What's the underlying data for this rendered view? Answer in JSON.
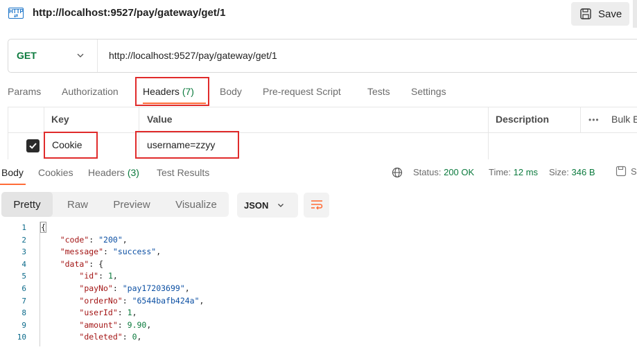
{
  "request": {
    "title": "http://localhost:9527/pay/gateway/get/1",
    "save_label": "Save",
    "method": "GET",
    "url": "http://localhost:9527/pay/gateway/get/1",
    "http_icon_text": "HTTP"
  },
  "request_tabs": [
    {
      "label": "Params"
    },
    {
      "label": "Authorization"
    },
    {
      "label": "Headers",
      "count": "(7)"
    },
    {
      "label": "Body"
    },
    {
      "label": "Pre-request Script"
    },
    {
      "label": "Tests"
    },
    {
      "label": "Settings"
    }
  ],
  "headers_table": {
    "columns": {
      "key": "Key",
      "value": "Value",
      "description": "Description",
      "bulk": "Bulk E"
    },
    "rows": [
      {
        "checked": true,
        "key": "Cookie",
        "value": "username=zzyy",
        "description": ""
      }
    ]
  },
  "response_tabs": [
    {
      "label": "Body"
    },
    {
      "label": "Cookies"
    },
    {
      "label": "Headers",
      "count": "(3)"
    },
    {
      "label": "Test Results"
    }
  ],
  "response_status": {
    "status_label": "Status:",
    "status_value": "200 OK",
    "time_label": "Time:",
    "time_value": "12 ms",
    "size_label": "Size:",
    "size_value": "346 B",
    "save_response_label": "S"
  },
  "view_modes": [
    "Pretty",
    "Raw",
    "Preview",
    "Visualize"
  ],
  "format_select": "JSON",
  "code_lines": [
    {
      "n": "1",
      "text": "{"
    },
    {
      "n": "2",
      "text": "    \"code\": \"200\","
    },
    {
      "n": "3",
      "text": "    \"message\": \"success\","
    },
    {
      "n": "4",
      "text": "    \"data\": {"
    },
    {
      "n": "5",
      "text": "        \"id\": 1,"
    },
    {
      "n": "6",
      "text": "        \"payNo\": \"pay17203699\","
    },
    {
      "n": "7",
      "text": "        \"orderNo\": \"6544bafb424a\","
    },
    {
      "n": "8",
      "text": "        \"userId\": 1,"
    },
    {
      "n": "9",
      "text": "        \"amount\": 9.90,"
    },
    {
      "n": "10",
      "text": "        \"deleted\": 0,"
    }
  ],
  "colors": {
    "accent": "#ff6c37",
    "method_get": "#0b7a3d",
    "annotation_red": "#e02b2b",
    "json_key": "#a31515",
    "json_string": "#0b4fa3",
    "json_number": "#0b7a3d"
  }
}
